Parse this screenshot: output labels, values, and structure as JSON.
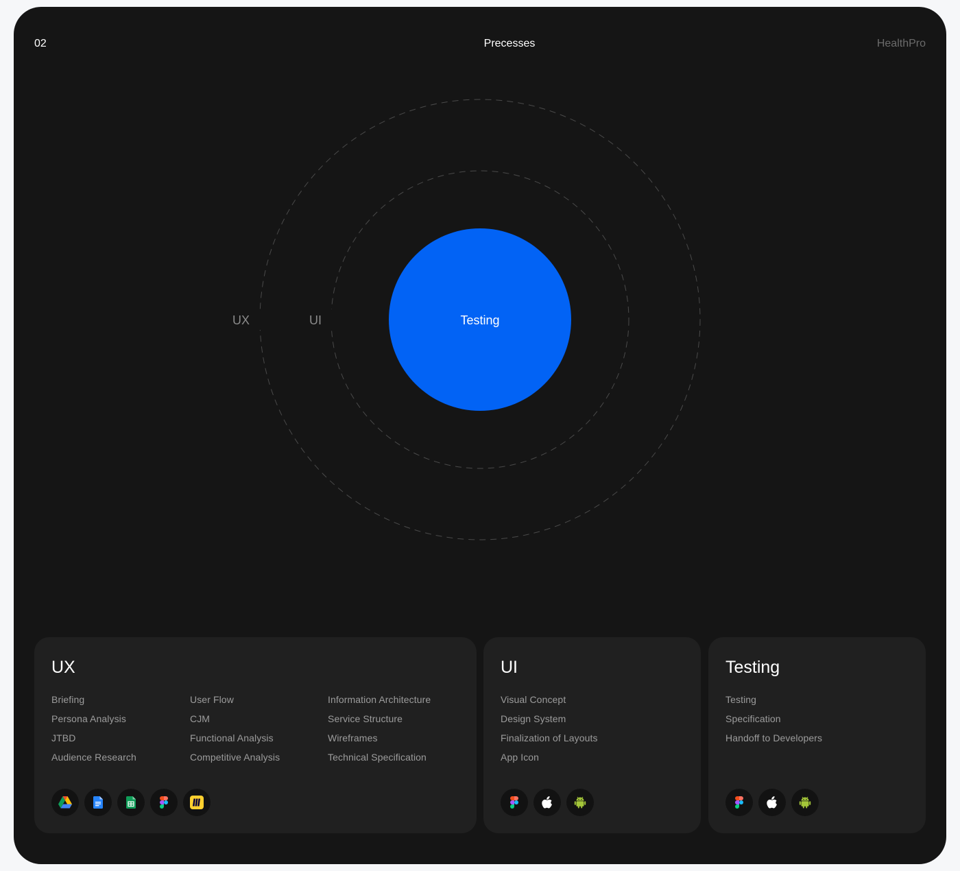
{
  "header": {
    "page_number": "02",
    "title": "Precesses",
    "brand": "HealthPro"
  },
  "diagram": {
    "outer_label": "UX",
    "middle_label": "UI",
    "center_label": "Testing",
    "center_color": "#0263f5"
  },
  "cards": {
    "ux": {
      "title": "UX",
      "col1": [
        "Briefing",
        "Persona Analysis",
        "JTBD",
        "Audience Research"
      ],
      "col2": [
        "User Flow",
        "CJM",
        "Functional Analysis",
        "Competitive Analysis"
      ],
      "col3": [
        "Information Architecture",
        "Service Structure",
        "Wireframes",
        "Technical Specification"
      ],
      "tools": [
        "google-drive-icon",
        "google-docs-icon",
        "google-sheets-icon",
        "figma-icon",
        "miro-icon"
      ]
    },
    "ui": {
      "title": "UI",
      "items": [
        "Visual Concept",
        "Design System",
        "Finalization of Layouts",
        "App Icon"
      ],
      "tools": [
        "figma-icon",
        "apple-icon",
        "android-icon"
      ]
    },
    "testing": {
      "title": "Testing",
      "items": [
        "Testing",
        "Specification",
        "Handoff to Developers"
      ],
      "tools": [
        "figma-icon",
        "apple-icon",
        "android-icon"
      ]
    }
  }
}
